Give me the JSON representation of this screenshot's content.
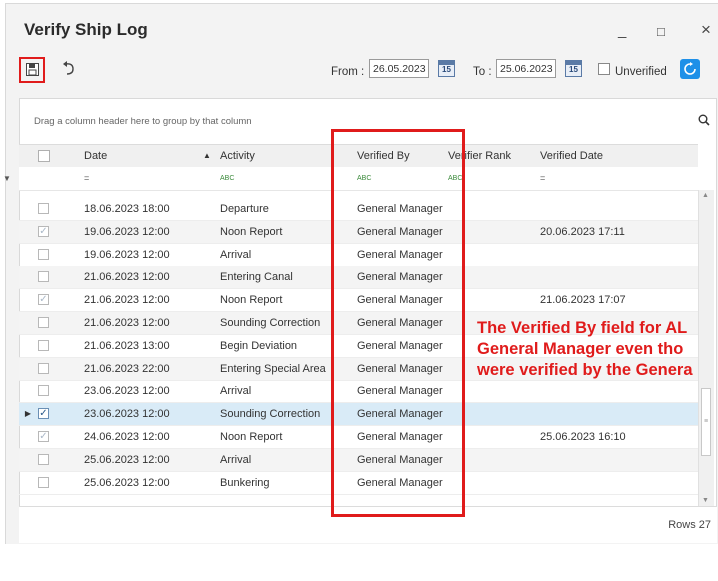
{
  "window": {
    "title": "Verify Ship Log",
    "minimize": "_",
    "maximize": "□",
    "close": "×"
  },
  "toolbar": {
    "from_label": "From :",
    "from_date": "26.05.2023",
    "to_label": "To :",
    "to_date": "25.06.2023",
    "calendar_label": "15",
    "unverified_label": "Unverified",
    "icons": [
      "save-icon",
      "undo-icon",
      "calendar-icon",
      "refresh-icon"
    ]
  },
  "grid": {
    "group_hint": "Drag a column header here to group by that column",
    "columns": [
      "Date",
      "Activity",
      "Verified By",
      "Verifier Rank",
      "Verified Date"
    ],
    "filter_symbols": {
      "date": "=",
      "text": "ABC",
      "verified_date": "="
    },
    "rows": [
      {
        "checked": false,
        "date": "18.06.2023 18:00",
        "activity": "Departure",
        "verified_by": "General Manager",
        "verifier_rank": "",
        "verified_date": ""
      },
      {
        "checked": true,
        "date": "19.06.2023 12:00",
        "activity": "Noon Report",
        "verified_by": "General Manager",
        "verifier_rank": "",
        "verified_date": "20.06.2023 17:11"
      },
      {
        "checked": false,
        "date": "19.06.2023 12:00",
        "activity": "Arrival",
        "verified_by": "General Manager",
        "verifier_rank": "",
        "verified_date": ""
      },
      {
        "checked": false,
        "date": "21.06.2023 12:00",
        "activity": "Entering Canal",
        "verified_by": "General Manager",
        "verifier_rank": "",
        "verified_date": ""
      },
      {
        "checked": true,
        "date": "21.06.2023 12:00",
        "activity": "Noon Report",
        "verified_by": "General Manager",
        "verifier_rank": "",
        "verified_date": "21.06.2023 17:07"
      },
      {
        "checked": false,
        "date": "21.06.2023 12:00",
        "activity": "Sounding Correction",
        "verified_by": "General Manager",
        "verifier_rank": "",
        "verified_date": ""
      },
      {
        "checked": false,
        "date": "21.06.2023 13:00",
        "activity": "Begin Deviation",
        "verified_by": "General Manager",
        "verifier_rank": "",
        "verified_date": ""
      },
      {
        "checked": false,
        "date": "21.06.2023 22:00",
        "activity": "Entering Special Area",
        "verified_by": "General Manager",
        "verifier_rank": "",
        "verified_date": ""
      },
      {
        "checked": false,
        "date": "23.06.2023 12:00",
        "activity": "Arrival",
        "verified_by": "General Manager",
        "verifier_rank": "",
        "verified_date": ""
      },
      {
        "checked": true,
        "date": "23.06.2023 12:00",
        "activity": "Sounding Correction",
        "verified_by": "General Manager",
        "verifier_rank": "",
        "verified_date": ""
      },
      {
        "checked": true,
        "date": "24.06.2023 12:00",
        "activity": "Noon Report",
        "verified_by": "General Manager",
        "verifier_rank": "",
        "verified_date": "25.06.2023 16:10"
      },
      {
        "checked": false,
        "date": "25.06.2023 12:00",
        "activity": "Arrival",
        "verified_by": "General Manager",
        "verifier_rank": "",
        "verified_date": ""
      },
      {
        "checked": false,
        "date": "25.06.2023 12:00",
        "activity": "Bunkering",
        "verified_by": "General Manager",
        "verifier_rank": "",
        "verified_date": ""
      }
    ],
    "selected_row": 9,
    "footer": "Rows 27"
  },
  "annotation": {
    "lines": [
      "The Verified By field for AL",
      "General Manager even tho",
      "were verified by the Genera"
    ],
    "color": "#e01b1b"
  }
}
